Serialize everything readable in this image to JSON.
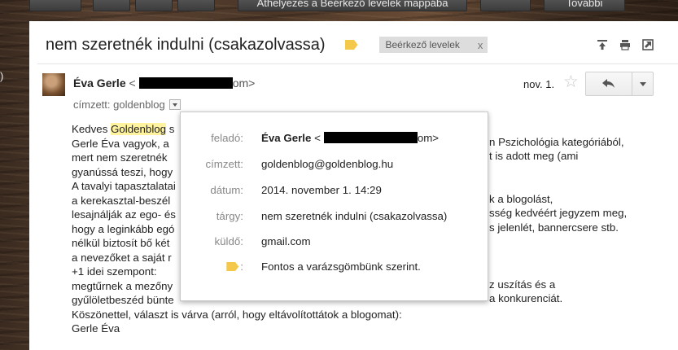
{
  "toolbar": {
    "move_to_inbox": "Áthelyezés a Beérkező levelek mappába",
    "more": "További"
  },
  "side_glyph": ")",
  "message": {
    "subject": "nem szeretnék indulni (csakazolvassa)",
    "label_chip": "Beérkező levelek",
    "label_chip_close": "x",
    "sender_name": "Éva Gerle",
    "sender_email_open": "<",
    "sender_email_tail": "om>",
    "to_prefix": "címzett: goldenblog",
    "date": "nov. 1.",
    "star": "☆"
  },
  "body_lines": [
    {
      "pre": "Kedves ",
      "hl": "Goldenblog",
      "post": " s"
    },
    {
      "pre": "Gerle Éva vagyok, a ",
      "hl": "",
      "post": ""
    },
    {
      "pre": "mert nem szeretnék",
      "hl": "",
      "post": ""
    },
    {
      "pre": "gyanússá teszi, hogy",
      "hl": "",
      "post": ""
    },
    {
      "pre": "A tavalyi tapasztalatai",
      "hl": "",
      "post": ""
    },
    {
      "pre": "a kerekasztal-beszél",
      "hl": "",
      "post": ""
    },
    {
      "pre": "lesajnálják az ego- és",
      "hl": "",
      "post": ""
    },
    {
      "pre": "hogy a leginkább egó",
      "hl": "",
      "post": ""
    },
    {
      "pre": "nélkül biztosít bő két",
      "hl": "",
      "post": ""
    },
    {
      "pre": "a nevezőket a saját r",
      "hl": "",
      "post": ""
    },
    {
      "pre": "+1 idei szempont:",
      "hl": "",
      "post": ""
    },
    {
      "pre": "megtűrnek a mezőny",
      "hl": "",
      "post": ""
    },
    {
      "pre": "gyűlöletbeszéd bünte",
      "hl": "",
      "post": ""
    },
    {
      "pre": "Köszönettel, választ is várva (arról, hogy eltávolítottátok a blogomat):",
      "hl": "",
      "post": ""
    },
    {
      "pre": "Gerle Éva",
      "hl": "",
      "post": ""
    }
  ],
  "body_right_fragments": [
    "n Pszichológia kategóriából,",
    "t is adott meg (ami",
    "k a blogolást,",
    "sség kedvéért jegyzem meg,",
    "s jelenlét, bannercsere stb.",
    "z uszítás és a",
    "a konkurenciát."
  ],
  "details": {
    "from_label": "feladó:",
    "from_name": "Éva Gerle",
    "from_email_open": "<",
    "from_email_tail": "om>",
    "to_label": "címzett:",
    "to_value": "goldenblog@goldenblog.hu",
    "date_label": "dátum:",
    "date_value": "2014. november 1. 14:29",
    "subject_label": "tárgy:",
    "subject_value": "nem szeretnék indulni (csakazolvassa)",
    "mailed_by_label": "küldő:",
    "mailed_by_value": "gmail.com",
    "importance_label": ":",
    "importance_value": "Fontos a varázsgömbünk szerint."
  }
}
